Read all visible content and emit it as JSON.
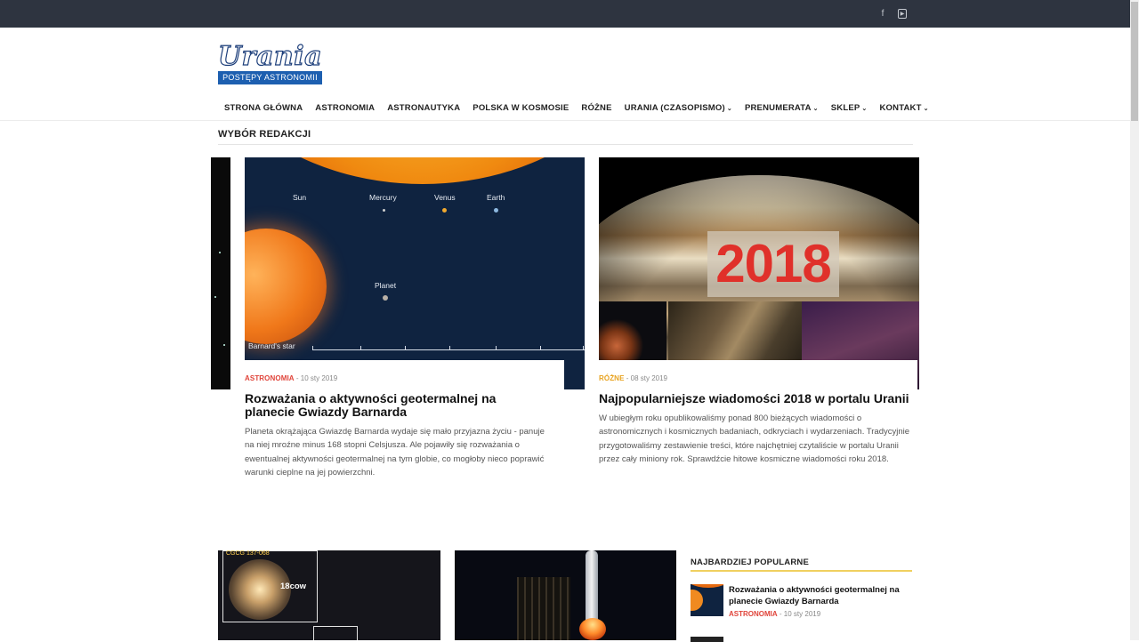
{
  "topbar": {
    "social": [
      {
        "icon": "facebook-icon",
        "glyph": "f"
      },
      {
        "icon": "youtube-icon",
        "glyph": "▶"
      }
    ]
  },
  "logo": {
    "name": "Urania",
    "tagline": "POSTĘPY ASTRONOMII"
  },
  "nav": {
    "items": [
      {
        "label": "STRONA GŁÓWNA",
        "dropdown": false
      },
      {
        "label": "ASTRONOMIA",
        "dropdown": false
      },
      {
        "label": "ASTRONAUTYKA",
        "dropdown": false
      },
      {
        "label": "POLSKA W KOSMOSIE",
        "dropdown": false
      },
      {
        "label": "RÓŻNE",
        "dropdown": false
      },
      {
        "label": "URANIA (CZASOPISMO)",
        "dropdown": true
      },
      {
        "label": "PRENUMERATA",
        "dropdown": true
      },
      {
        "label": "SKLEP",
        "dropdown": true
      },
      {
        "label": "KONTAKT",
        "dropdown": true
      }
    ]
  },
  "editors_pick": {
    "heading": "WYBÓR REDAKCJI",
    "cards": [
      {
        "image_labels": {
          "sun": "Sun",
          "mercury": "Mercury",
          "venus": "Venus",
          "earth": "Earth",
          "planet": "Planet",
          "star": "Barnard's star"
        },
        "category": "ASTRONOMIA",
        "category_color": "#e0443a",
        "date": "10 sty 2019",
        "title": "Rozważania o aktywności geotermalnej na planecie Gwiazdy Barnarda",
        "excerpt": "Planeta okrążająca Gwiazdę Barnarda wydaje się mało przyjazna życiu - panuje na niej mroźne minus 168 stopni Celsjusza. Ale pojawiły się rozważania o ewentualnej aktywności geotermalnej na tym globie, co mogłoby nieco poprawić warunki cieplne na jej powierzchni."
      },
      {
        "image_text": "2018",
        "category": "RÓŻNE",
        "category_color": "#e8a320",
        "date": "08 sty 2019",
        "title": "Najpopularniejsze wiadomości 2018 w portalu Uranii",
        "excerpt": "W ubiegłym roku opublikowaliśmy ponad 800 bieżących wiadomości o astronomicznych i kosmicznych badaniach, odkryciach i wydarzeniach. Tradycyjnie przygotowaliśmy zestawienie treści, które najchętniej czytaliście w portalu Uranii przez cały miniony rok. Sprawdźcie hitowe kosmiczne wiadomości roku 2018."
      }
    ]
  },
  "bottom": {
    "galaxy_labels": {
      "catalog": "CGCG 137-068",
      "object": "18cow"
    }
  },
  "popular": {
    "heading": "NAJBARDZIEJ POPULARNE",
    "items": [
      {
        "title": "Rozważania o aktywności geotermalnej na planecie Gwiazdy Barnarda",
        "category": "ASTRONOMIA",
        "category_color": "#e0443a",
        "date": "10 sty 2019"
      }
    ]
  }
}
